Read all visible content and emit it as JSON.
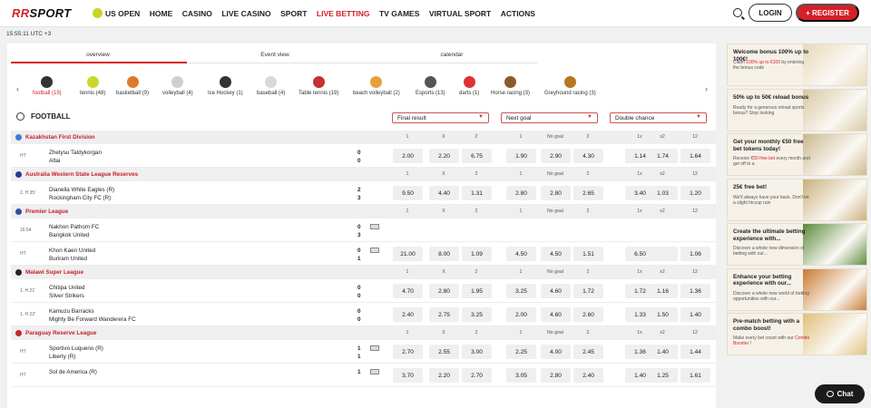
{
  "brand": {
    "logo_rr": "RR",
    "logo_text": "SPORT"
  },
  "nav": [
    {
      "label": "US OPEN"
    },
    {
      "label": "HOME"
    },
    {
      "label": "CASINO"
    },
    {
      "label": "LIVE CASINO"
    },
    {
      "label": "SPORT"
    },
    {
      "label": "LIVE BETTING",
      "active": true
    },
    {
      "label": "TV GAMES"
    },
    {
      "label": "VIRTUAL SPORT"
    },
    {
      "label": "ACTIONS"
    }
  ],
  "auth": {
    "login": "LOGIN",
    "register": "+ REGISTER"
  },
  "clock": "15:55:11 UTC +3",
  "tabs": [
    "overview",
    "Event view",
    "calendar"
  ],
  "sports": [
    {
      "label": "football (19)",
      "color": "#333",
      "active": true
    },
    {
      "label": "tennis (48)",
      "color": "#c9d62c"
    },
    {
      "label": "basketball (9)",
      "color": "#e07a2a"
    },
    {
      "label": "volleyball (4)",
      "color": "#cfcfcf"
    },
    {
      "label": "Ice Hockey (1)",
      "color": "#333"
    },
    {
      "label": "baseball (4)",
      "color": "#d8d8d8"
    },
    {
      "label": "Table tennis (19)",
      "color": "#c53030"
    },
    {
      "label": "beach volleyball (2)",
      "color": "#e6a13a"
    },
    {
      "label": "Esports (13)",
      "color": "#555"
    },
    {
      "label": "darts (1)",
      "color": "#d33"
    },
    {
      "label": "Horse racing (3)",
      "color": "#8b5a2b"
    },
    {
      "label": "Greyhound racing (3)",
      "color": "#b7771e"
    }
  ],
  "section_title": "FOOTBALL",
  "dropdowns": [
    "Final result",
    "Next goal",
    "Double chance"
  ],
  "col_headers": {
    "g1": [
      "1",
      "X",
      "2"
    ],
    "g2": [
      "1",
      "No goal",
      "2"
    ],
    "g3": [
      "1x",
      "x2",
      "12"
    ]
  },
  "leagues": [
    {
      "name": "Kazakhstan First Division",
      "flag": "#3b7bd4",
      "matches": [
        {
          "time": "HT",
          "team1": "Zhetysu Taldykorgan",
          "team2": "Altai",
          "score1": "0",
          "score2": "0",
          "tv": false,
          "odds": [
            "2.00",
            "2.20",
            "6.75",
            "1.90",
            "2.90",
            "4.30",
            "1.14",
            "1.74",
            "1.64"
          ]
        }
      ]
    },
    {
      "name": "Australia Western State League Reserves",
      "flag": "#1f3f8f",
      "matches": [
        {
          "time": "2. H  35'",
          "team1": "Dianella White Eagles (R)",
          "team2": "Rockingham City FC (R)",
          "score1": "2",
          "score2": "3",
          "tv": false,
          "odds": [
            "9.50",
            "4.40",
            "1.31",
            "2.80",
            "2.80",
            "2.65",
            "3.40",
            "1.03",
            "1.20"
          ]
        }
      ]
    },
    {
      "name": "Premier League",
      "flag": "#2b4fa5",
      "matches": [
        {
          "time": "16:54",
          "team1": "Nakhon Pathom FC",
          "team2": "Bangkok United",
          "score1": "0",
          "score2": "3",
          "tv": true,
          "odds": []
        },
        {
          "time": "HT",
          "team1": "Khon Kaen United",
          "team2": "Buriram United",
          "score1": "0",
          "score2": "1",
          "tv": true,
          "odds": [
            "21.00",
            "8.00",
            "1.09",
            "4.50",
            "4.50",
            "1.51",
            "6.50",
            "",
            "1.06"
          ]
        }
      ]
    },
    {
      "name": "Malawi Super League",
      "flag": "#222",
      "matches": [
        {
          "time": "1. H  21'",
          "team1": "Chitipa United",
          "team2": "Silver Strikers",
          "score1": "0",
          "score2": "0",
          "tv": false,
          "odds": [
            "4.70",
            "2.80",
            "1.95",
            "3.25",
            "4.60",
            "1.72",
            "1.72",
            "1.16",
            "1.36"
          ]
        },
        {
          "time": "1. H  22'",
          "team1": "Kamuzu Barracks",
          "team2": "Mighty Be Forward Wanderera FC",
          "score1": "0",
          "score2": "0",
          "tv": false,
          "odds": [
            "2.40",
            "2.75",
            "3.25",
            "2.00",
            "4.60",
            "2.60",
            "1.33",
            "1.50",
            "1.40"
          ]
        }
      ]
    },
    {
      "name": "Paraguay Reserve League",
      "flag": "#c0282d",
      "matches": [
        {
          "time": "HT",
          "team1": "Sportivo Luqueno (R)",
          "team2": "Liberty (R)",
          "score1": "1",
          "score2": "1",
          "tv": true,
          "odds": [
            "2.70",
            "2.55",
            "3.00",
            "2.25",
            "4.00",
            "2.45",
            "1.36",
            "1.40",
            "1.44"
          ]
        },
        {
          "time": "HT",
          "team1": "Sol de America (R)",
          "team2": "",
          "score1": "1",
          "score2": "",
          "tv": true,
          "odds": [
            "3.70",
            "2.20",
            "2.70",
            "3.05",
            "2.80",
            "2.40",
            "1.40",
            "1.25",
            "1.61"
          ]
        }
      ]
    }
  ],
  "promos": [
    {
      "title": "Welcome bonus 100% up to 100€!",
      "desc_a": "Claim ",
      "desc_hl": "100% up to €100",
      "desc_b": " by entering the bonus code",
      "bg": "#e8d9b8"
    },
    {
      "title": "50% up to 50€ reload bonus",
      "desc_a": "Ready for a generous reload sports bonus? Stop looking",
      "desc_hl": "",
      "desc_b": "",
      "bg": "#d7c7a0"
    },
    {
      "title": "Get your monthly €50 free bet tokens today!",
      "desc_a": "Receive ",
      "desc_hl": "€50 free bet",
      "desc_b": " every month and get off to a",
      "bg": "#cbb88c"
    },
    {
      "title": "25€ free bet!",
      "desc_a": "We'll always have your back. Don't let a slight hiccup ruin",
      "desc_hl": "",
      "desc_b": "",
      "bg": "#c9b07a"
    },
    {
      "title": "Create the ultimate betting experience with...",
      "desc_a": "Discover a whole new dimension of betting with our...",
      "desc_hl": "",
      "desc_b": "",
      "bg": "#5a8a3a"
    },
    {
      "title": "Enhance your betting experience with our...",
      "desc_a": "Discover a whole new world of betting opportunities with our...",
      "desc_hl": "",
      "desc_b": "",
      "bg": "#c77a30"
    },
    {
      "title": "Pre-match betting with a combo boost!",
      "desc_a": "Make every bet count with our ",
      "desc_hl": "Combo Booster",
      "desc_b": " !",
      "bg": "#e0c07a"
    }
  ],
  "chat": "Chat"
}
